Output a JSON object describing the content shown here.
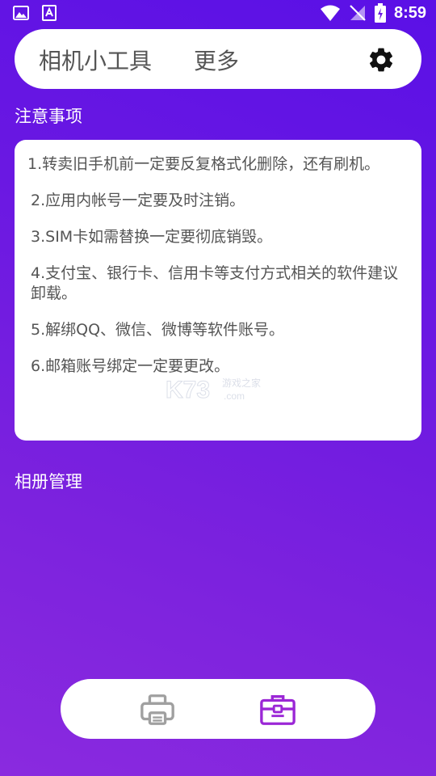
{
  "status_bar": {
    "time": "8:59"
  },
  "header": {
    "tabs": [
      {
        "label": "相机小工具"
      },
      {
        "label": "更多"
      }
    ]
  },
  "notes": {
    "title": "注意事项",
    "items": [
      "1.转卖旧手机前一定要反复格式化删除，还有刷机。",
      "2.应用内帐号一定要及时注销。",
      "3.SIM卡如需替换一定要彻底销毁。",
      "4.支付宝、银行卡、信用卡等支付方式相关的软件建议卸载。",
      "5.解绑QQ、微信、微博等软件账号。",
      "6.邮箱账号绑定一定要更改。"
    ]
  },
  "album": {
    "title": "相册管理"
  },
  "watermark": {
    "brand": "K73",
    "site": "游戏之家",
    "domain": ".com"
  },
  "colors": {
    "accent": "#9b27d6",
    "icon_gray": "#a0a0a0",
    "text_gray": "#555555"
  },
  "icons": {
    "settings": "gear-icon",
    "print": "printer-icon",
    "tools": "toolbox-icon"
  }
}
